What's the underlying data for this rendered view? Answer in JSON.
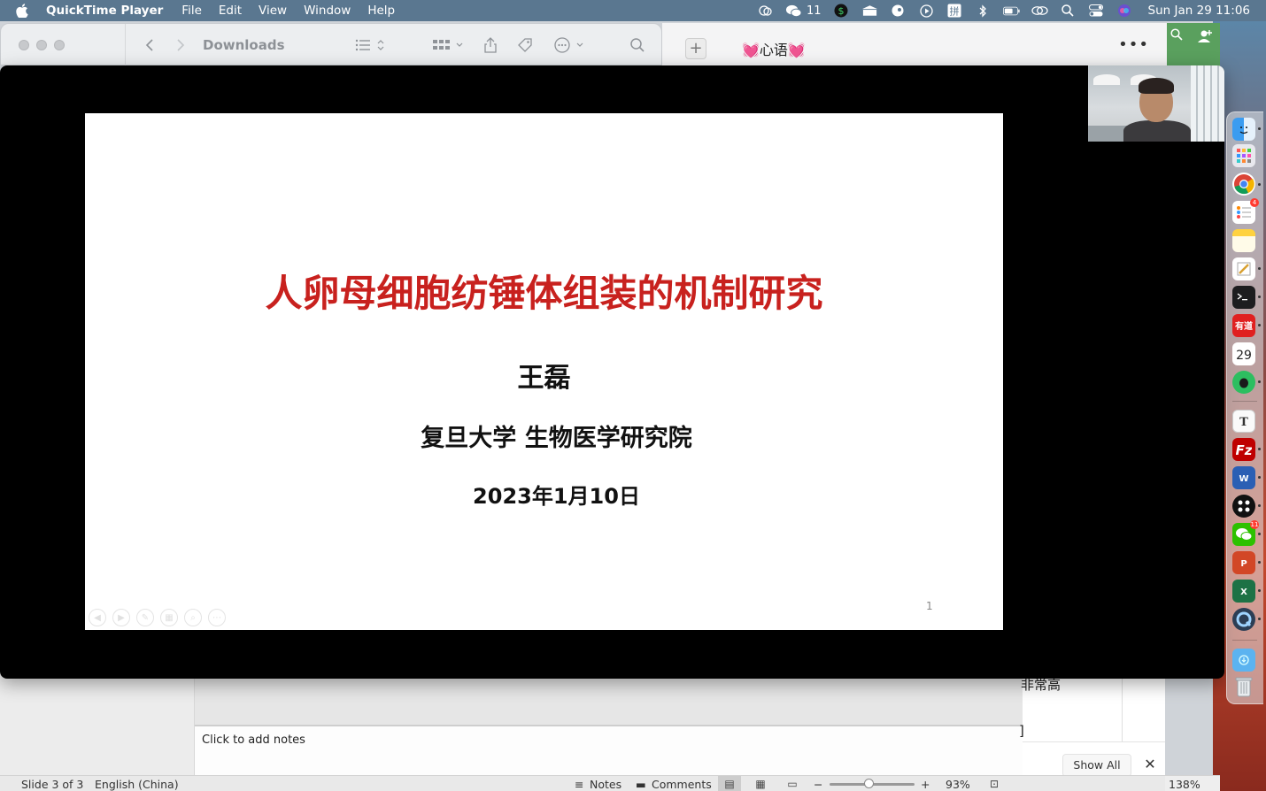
{
  "menubar": {
    "app_name": "QuickTime Player",
    "menus": [
      "File",
      "Edit",
      "View",
      "Window",
      "Help"
    ],
    "wechat_count": "11",
    "datetime": "Sun Jan 29  11:06"
  },
  "finder": {
    "title": "Downloads"
  },
  "chat": {
    "title": "💓心语💓"
  },
  "slide": {
    "title": "人卵母细胞纺锤体组装的机制研究",
    "author": "王磊",
    "institution": "复旦大学 生物医学研究院",
    "date": "2023年1月10日",
    "page_number": "1"
  },
  "powerpoint": {
    "notes_placeholder": "Click to add notes",
    "right_fragment": "非常高",
    "bracket_fragment": "]",
    "show_all": "Show All",
    "status": {
      "slide_info": "Slide 3 of 3",
      "language": "English (China)",
      "notes": "Notes",
      "comments": "Comments",
      "zoom": "93%"
    },
    "side_zoom": "138%"
  },
  "dock": {
    "calendar_day": "29",
    "reminders_badge": "4",
    "wechat_badge": "11"
  }
}
